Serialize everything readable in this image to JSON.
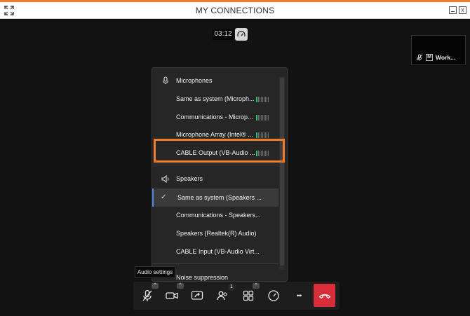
{
  "window": {
    "title": "MY CONNECTIONS",
    "close_glyph": "x"
  },
  "call": {
    "timer": "03:12"
  },
  "self_view": {
    "badge": "M",
    "name": "Work..."
  },
  "audio_menu": {
    "microphones_header": "Microphones",
    "microphones": [
      {
        "label": "Same as system (Microph...",
        "level": 0.1
      },
      {
        "label": "Communications - Microp...",
        "level": 0.1
      },
      {
        "label": "Microphone Array (Intel® ...",
        "level": 0.1
      },
      {
        "label": "CABLE Output (VB-Audio ...",
        "level": 0.1
      }
    ],
    "speakers_header": "Speakers",
    "speakers": [
      {
        "label": "Same as system (Speakers ...",
        "selected": true
      },
      {
        "label": "Communications - Speakers...",
        "selected": false
      },
      {
        "label": "Speakers (Realtek(R) Audio)",
        "selected": false
      },
      {
        "label": "CABLE Input (VB-Audio Virt...",
        "selected": false
      }
    ],
    "noise_label": "Noise suppression"
  },
  "toolbar": {
    "tooltip": "Audio settings",
    "caret_glyph": "^",
    "participants_count": "1",
    "more_glyph": "•••"
  },
  "icons": {
    "expand": "expand-icon",
    "mic_muted": "mic-off-icon",
    "camera": "camera-icon",
    "share": "share-screen-icon",
    "participants": "participants-icon",
    "layout": "grid-layout-icon",
    "speed": "speedometer-icon",
    "hangup": "hang-up-icon"
  },
  "colors": {
    "accent": "#f07c2a",
    "hangup": "#d72e3a",
    "level_on": "#2fbf6a",
    "selection": "#4a8ae0"
  }
}
